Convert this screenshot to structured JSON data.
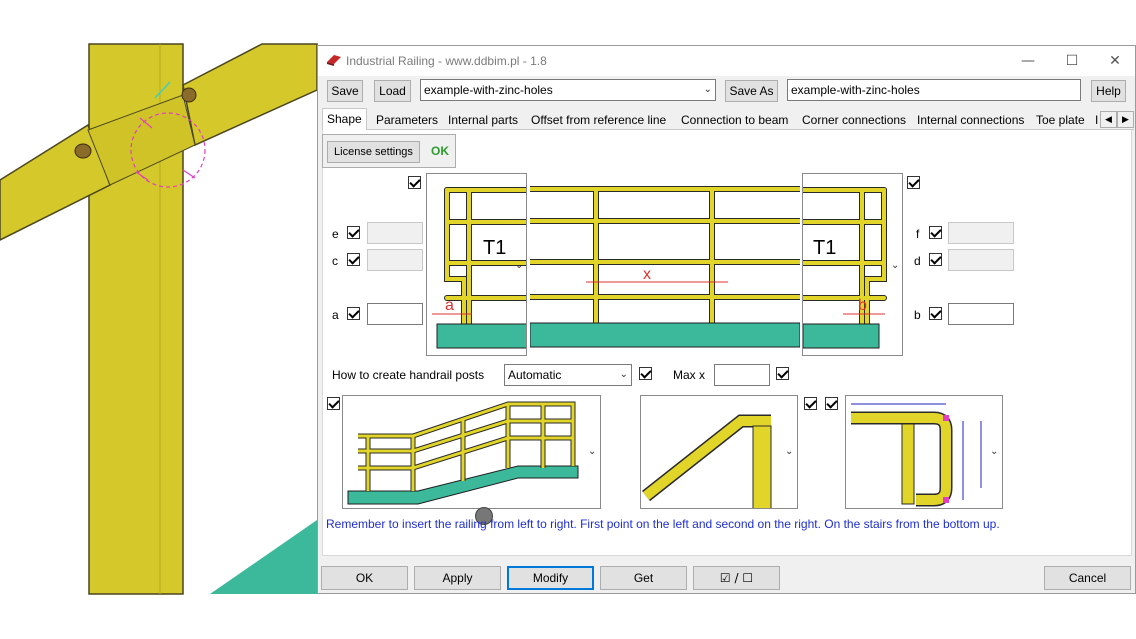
{
  "window": {
    "title": "Industrial Railing - www.ddbim.pl - 1.8",
    "minimize": "—",
    "maximize": "☐",
    "close": "✕"
  },
  "toolbar": {
    "save_label": "Save",
    "load_label": "Load",
    "preset_value": "example-with-zinc-holes",
    "save_as_label": "Save As",
    "save_as_value": "example-with-zinc-holes",
    "help_label": "Help"
  },
  "tabs": [
    "Shape",
    "Parameters",
    "Internal parts",
    "Offset from reference line",
    "Connection to beam",
    "Corner connections",
    "Internal connections",
    "Toe plate",
    "I"
  ],
  "license": {
    "button_label": "License settings",
    "status": "OK"
  },
  "shape": {
    "labels": {
      "e": "e",
      "c": "c",
      "a": "a",
      "f": "f",
      "d": "d",
      "b": "b"
    },
    "fields": {
      "e": "",
      "c": "",
      "a": "",
      "f": "",
      "d": "",
      "b": ""
    },
    "diagram_labels": {
      "t1_left": "T1",
      "t1_right": "T1",
      "x": "x",
      "a": "a",
      "b": "b"
    },
    "posts_label": "How to create handrail posts",
    "posts_value": "Automatic",
    "max_x_label": "Max x",
    "max_x_value": ""
  },
  "hint": "Remember to insert the railing from left to right. First point on the left and second on the right. On the stairs from the bottom up.",
  "footer": {
    "ok": "OK",
    "apply": "Apply",
    "modify": "Modify",
    "get": "Get",
    "toggle": "☑ / ☐",
    "cancel": "Cancel"
  },
  "colors": {
    "rail": "#e1d52a",
    "base": "#3cb89a",
    "accent": "#0078d7",
    "hint": "#1f2fd0",
    "ok": "#2e9c2e"
  }
}
